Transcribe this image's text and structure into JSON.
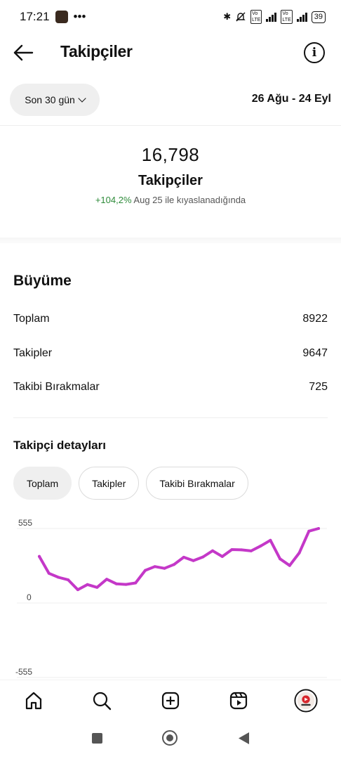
{
  "status_bar": {
    "time": "17:21",
    "dots": "•••",
    "battery": "39"
  },
  "header": {
    "title": "Takipçiler"
  },
  "filter": {
    "range_label": "Son 30 gün",
    "date_range": "26 Ağu - 24 Eyl"
  },
  "summary": {
    "count": "16,798",
    "label": "Takipçiler",
    "change": "+104,2%",
    "compare_text": "Aug 25 ile kıyaslanadığında"
  },
  "growth": {
    "title": "Büyüme",
    "rows": [
      {
        "label": "Toplam",
        "value": "8922"
      },
      {
        "label": "Takipler",
        "value": "9647"
      },
      {
        "label": "Takibi Bırakmalar",
        "value": "725"
      }
    ]
  },
  "details": {
    "title": "Takipçi detayları",
    "tabs": [
      "Toplam",
      "Takipler",
      "Takibi Bırakmalar"
    ],
    "active_tab": 0
  },
  "chart_data": {
    "type": "line",
    "ytick_labels": [
      "555",
      "0",
      "-555"
    ],
    "ylim": [
      -555,
      555
    ],
    "line_color": "#c438c8",
    "series": [
      {
        "values": [
          347,
          221,
          191,
          172,
          99,
          137,
          116,
          177,
          143,
          138,
          149,
          243,
          271,
          258,
          287,
          341,
          315,
          343,
          389,
          346,
          398,
          396,
          388,
          425,
          467,
          329,
          279,
          374,
          535,
          555
        ]
      }
    ]
  },
  "nav": {
    "icons": [
      "home-icon",
      "search-icon",
      "create-icon",
      "reels-icon",
      "profile-avatar"
    ]
  }
}
